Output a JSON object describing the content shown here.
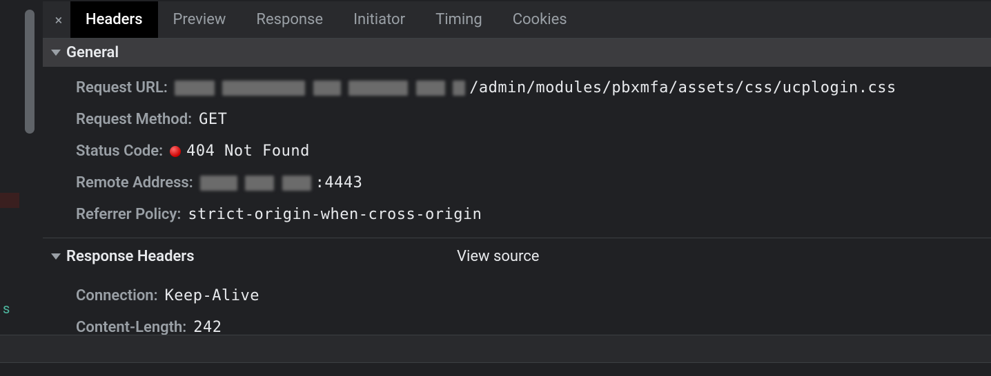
{
  "tabs": {
    "headers": "Headers",
    "preview": "Preview",
    "response": "Response",
    "initiator": "Initiator",
    "timing": "Timing",
    "cookies": "Cookies"
  },
  "sections": {
    "general": {
      "title": "General",
      "request_url_label": "Request URL:",
      "request_url_suffix": "/admin/modules/pbxmfa/assets/css/ucplogin.css",
      "request_method_label": "Request Method:",
      "request_method_value": "GET",
      "status_code_label": "Status Code:",
      "status_code_value": "404 Not Found",
      "remote_address_label": "Remote Address:",
      "remote_address_suffix": ":4443",
      "referrer_policy_label": "Referrer Policy:",
      "referrer_policy_value": "strict-origin-when-cross-origin"
    },
    "response_headers": {
      "title": "Response Headers",
      "view_source": "View source",
      "connection_label": "Connection:",
      "connection_value": "Keep-Alive",
      "content_length_label": "Content-Length:",
      "content_length_value": "242"
    }
  },
  "left_gutter": {
    "s": "s"
  }
}
